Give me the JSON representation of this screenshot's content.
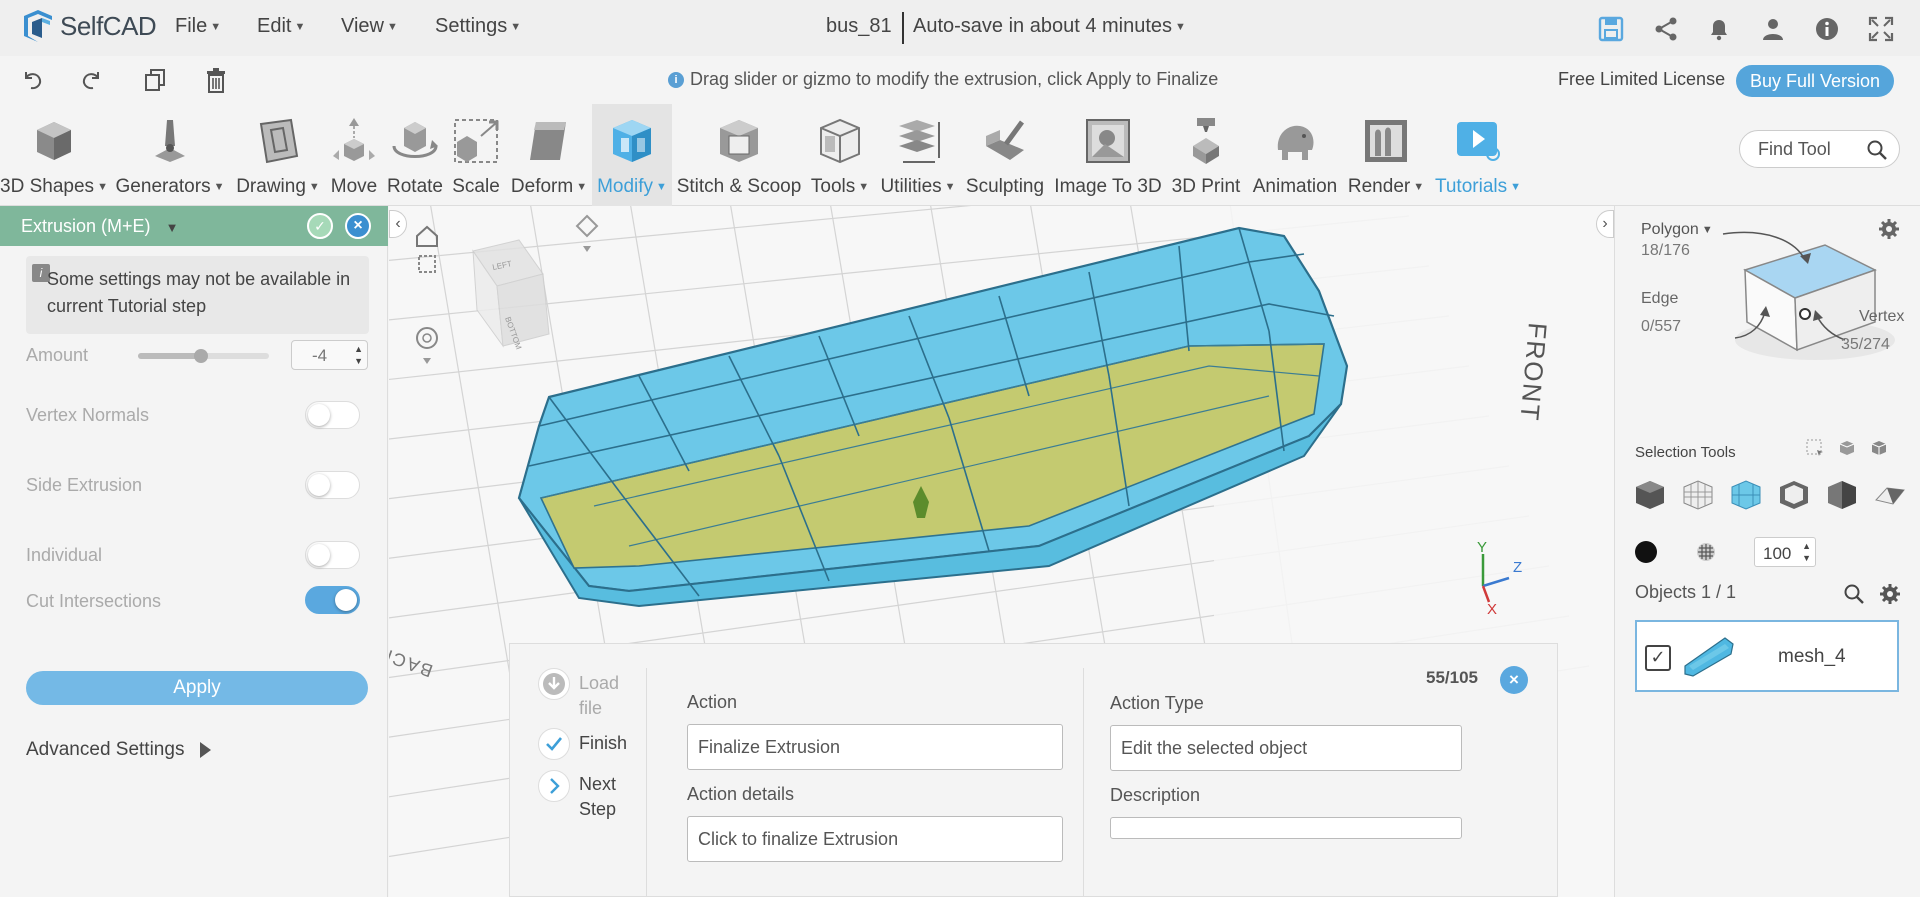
{
  "app": {
    "logo_text": "SelfCAD"
  },
  "menus": [
    "File",
    "Edit",
    "View",
    "Settings"
  ],
  "document": {
    "title": "bus_81",
    "autosave": "Auto-save in about 4 minutes"
  },
  "hint": "Drag slider or gizmo to modify the extrusion, click Apply to Finalize",
  "license": {
    "label": "Free Limited License",
    "buy_label": "Buy Full Version"
  },
  "toolbar": {
    "tools": [
      {
        "label": "3D Shapes",
        "dropdown": true
      },
      {
        "label": "Generators",
        "dropdown": true
      },
      {
        "label": "Drawing",
        "dropdown": true
      },
      {
        "label": "Move",
        "dropdown": false
      },
      {
        "label": "Rotate",
        "dropdown": false
      },
      {
        "label": "Scale",
        "dropdown": false
      },
      {
        "label": "Deform",
        "dropdown": true
      },
      {
        "label": "Modify",
        "dropdown": true
      },
      {
        "label": "Stitch & Scoop",
        "dropdown": false
      },
      {
        "label": "Tools",
        "dropdown": true
      },
      {
        "label": "Utilities",
        "dropdown": true
      },
      {
        "label": "Sculpting",
        "dropdown": false
      },
      {
        "label": "Image To 3D",
        "dropdown": false
      },
      {
        "label": "3D Print",
        "dropdown": false
      },
      {
        "label": "Animation",
        "dropdown": false
      },
      {
        "label": "Render",
        "dropdown": true
      },
      {
        "label": "Tutorials",
        "dropdown": true
      }
    ],
    "find_placeholder": "Find Tool"
  },
  "left_panel": {
    "title": "Extrusion (M+E)",
    "notice": "Some settings may not be available in current Tutorial step",
    "amount_label": "Amount",
    "amount_value": "-4",
    "amount_slider": 0.48,
    "options": [
      {
        "label": "Vertex Normals",
        "on": false
      },
      {
        "label": "Side Extrusion",
        "on": false
      },
      {
        "label": "Individual",
        "on": false
      },
      {
        "label": "Cut Intersections",
        "on": true
      }
    ],
    "apply_label": "Apply",
    "advanced_label": "Advanced Settings"
  },
  "viewport": {
    "nav_cube": {
      "left": "LEFT",
      "bottom": "BOTTOM"
    },
    "front_label": "FRONT",
    "back_label": "BACK",
    "axes": {
      "x": "X",
      "y": "Y",
      "z": "Z"
    },
    "colors": {
      "mesh": "#6cc8e8",
      "mesh_edge": "#2c6f8c",
      "selected_face": "#c9cb6a"
    }
  },
  "tutorial": {
    "steps": [
      {
        "label": "Load file",
        "state": "disabled"
      },
      {
        "label": "Finish",
        "state": "done"
      },
      {
        "label": "Next Step",
        "state": "next"
      }
    ],
    "counter": "55/105",
    "action_label": "Action",
    "action_value": "Finalize Extrusion",
    "action_details_label": "Action details",
    "action_details_value": "Click to finalize Extrusion",
    "action_type_label": "Action Type",
    "action_type_value": "Edit the selected object",
    "description_label": "Description",
    "description_value": ""
  },
  "right_panel": {
    "polygon_label": "Polygon",
    "polygon_count": "18/176",
    "edge_label": "Edge",
    "edge_count": "0/557",
    "vertex_label": "Vertex",
    "vertex_count": "35/274",
    "selection_tools_label": "Selection Tools",
    "opacity_value": "100",
    "objects_label": "Objects 1 / 1",
    "object_name": "mesh_4"
  }
}
